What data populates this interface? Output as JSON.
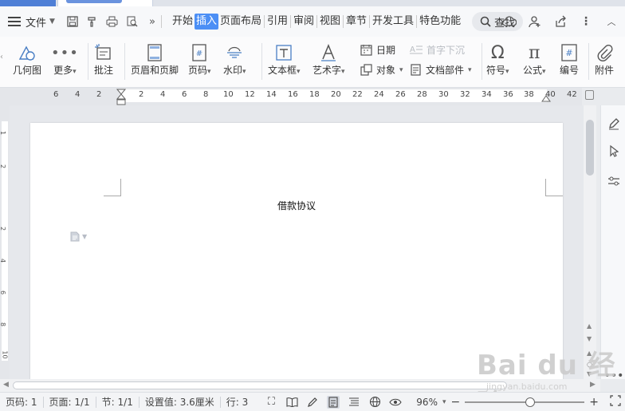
{
  "menubar": {
    "file_label": "文件",
    "tabs": [
      "开始",
      "插入",
      "页面布局",
      "引用",
      "审阅",
      "视图",
      "章节",
      "开发工具",
      "特色功能"
    ],
    "active_tab": "插入",
    "search_label": "查找"
  },
  "ribbon": {
    "shapes": "几何图",
    "more": "更多",
    "comment": "批注",
    "header_footer": "页眉和页脚",
    "page_number": "页码",
    "watermark": "水印",
    "textbox": "文本框",
    "wordart": "艺术字",
    "date": "日期",
    "object": "对象",
    "dropcap": "首字下沉",
    "doc_parts": "文档部件",
    "symbol": "符号",
    "formula": "公式",
    "numbering": "编号",
    "attachment": "附件"
  },
  "ruler": {
    "labels": [
      "6",
      "4",
      "2",
      "2",
      "4",
      "6",
      "8",
      "10",
      "12",
      "14",
      "16",
      "18",
      "20",
      "22",
      "24",
      "26",
      "28",
      "30",
      "32",
      "34",
      "36",
      "38",
      "40",
      "42"
    ],
    "vertical_labels": [
      "1",
      "2",
      "2",
      "4",
      "6",
      "8",
      "10"
    ]
  },
  "document": {
    "title": "借款协议"
  },
  "statusbar": {
    "page_code": "页码: 1",
    "page": "页面: 1/1",
    "section": "节: 1/1",
    "setting": "设置值: 3.6厘米",
    "row": "行: 3",
    "zoom": "96%",
    "zoom_level": 0.55
  },
  "watermark": {
    "brand": "Bai du 经验",
    "url": "jingyan.baidu.com"
  }
}
